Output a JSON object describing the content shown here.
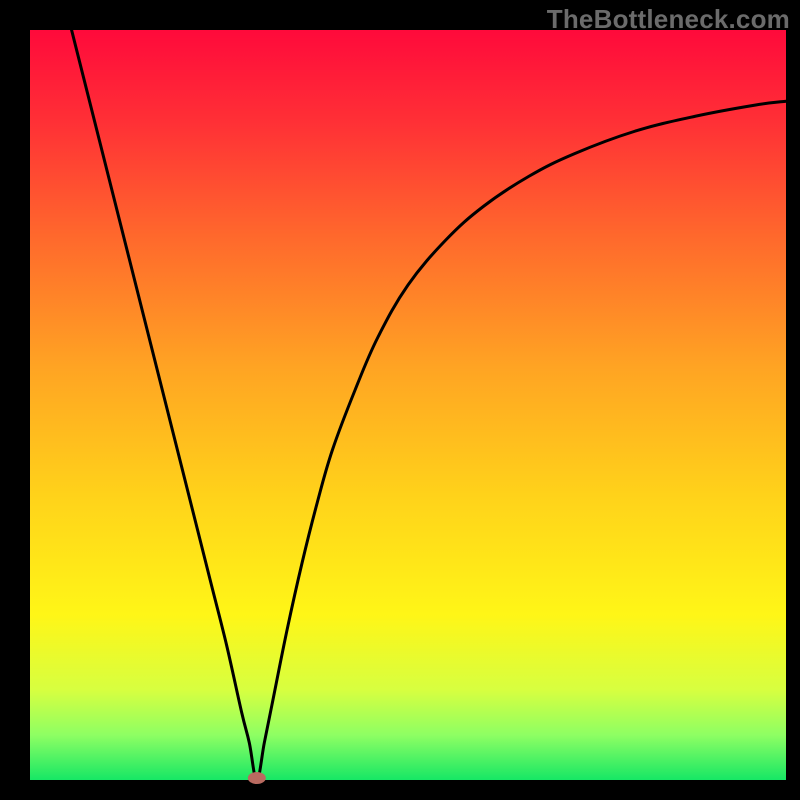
{
  "watermark": "TheBottleneck.com",
  "chart_data": {
    "type": "line",
    "title": "",
    "xlabel": "",
    "ylabel": "",
    "xlim": [
      0,
      100
    ],
    "ylim": [
      0,
      100
    ],
    "grid": false,
    "legend": false,
    "annotations": [],
    "notes": "Vertical gradient background from red (top) through orange/yellow to green (bottom). Black curve with a single minimum/cusp near x≈30, with a small brown marker at the minimum.",
    "gradient_stops": [
      {
        "offset": 0.0,
        "color": "#ff0a3b"
      },
      {
        "offset": 0.12,
        "color": "#ff2f36"
      },
      {
        "offset": 0.28,
        "color": "#ff6a2c"
      },
      {
        "offset": 0.45,
        "color": "#ffa423"
      },
      {
        "offset": 0.62,
        "color": "#ffd21a"
      },
      {
        "offset": 0.78,
        "color": "#fff617"
      },
      {
        "offset": 0.88,
        "color": "#d7ff40"
      },
      {
        "offset": 0.94,
        "color": "#8eff63"
      },
      {
        "offset": 1.0,
        "color": "#16e765"
      }
    ],
    "minimum_marker": {
      "x": 30,
      "y": 0,
      "color": "#b96a60"
    },
    "series": [
      {
        "name": "curve",
        "x": [
          5.5,
          8,
          10,
          12,
          14,
          16,
          18,
          20,
          22,
          24,
          26,
          28,
          29,
          30,
          31,
          32,
          34,
          36,
          38,
          40,
          43,
          46,
          50,
          55,
          60,
          66,
          72,
          80,
          88,
          96,
          100
        ],
        "values": [
          100,
          90,
          82,
          74,
          66,
          58,
          50,
          42,
          34,
          26,
          18,
          9,
          5,
          0,
          5,
          10,
          20,
          29,
          37,
          44,
          52,
          59,
          66,
          72,
          76.5,
          80.5,
          83.5,
          86.5,
          88.5,
          90,
          90.5
        ]
      }
    ]
  }
}
